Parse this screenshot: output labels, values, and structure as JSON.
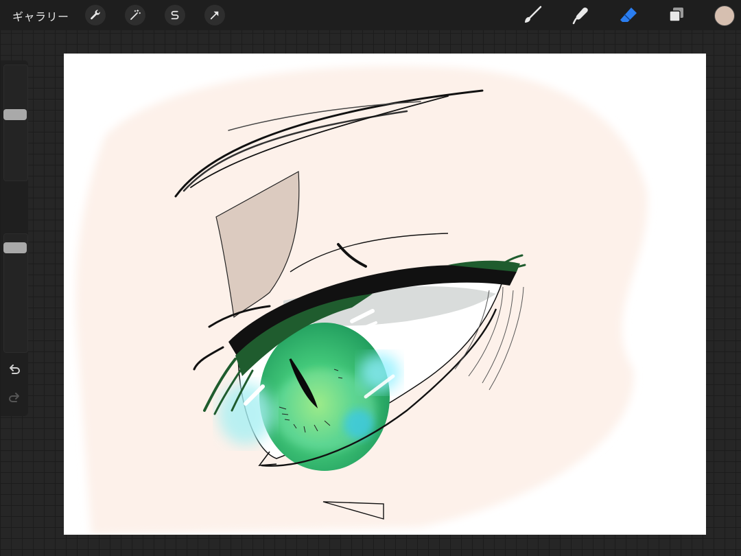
{
  "topbar": {
    "gallery_label": "ギャラリー",
    "left_tools": [
      {
        "name": "actions",
        "icon": "wrench-icon"
      },
      {
        "name": "adjustments",
        "icon": "magic-wand-icon"
      },
      {
        "name": "selection",
        "icon": "selection-s-icon"
      },
      {
        "name": "transform",
        "icon": "arrow-cursor-icon"
      }
    ],
    "right_tools": [
      {
        "name": "brush",
        "icon": "brush-icon",
        "active": false
      },
      {
        "name": "smudge",
        "icon": "smudge-icon",
        "active": false
      },
      {
        "name": "eraser",
        "icon": "eraser-icon",
        "active": true
      },
      {
        "name": "layers",
        "icon": "layers-icon",
        "active": false
      }
    ],
    "current_color": "#d6bfb0",
    "active_accent": "#2a7df0"
  },
  "sidebar": {
    "brush_size_level": 0.58,
    "opacity_level": 0.92,
    "buttons": [
      "modify-icon",
      "undo-icon",
      "redo-icon"
    ]
  },
  "canvas": {
    "background": "#ffffff",
    "skin_color": "#fdf1ea",
    "iris_color": "#3fc87a",
    "lash_color": "#1f5c2e"
  }
}
